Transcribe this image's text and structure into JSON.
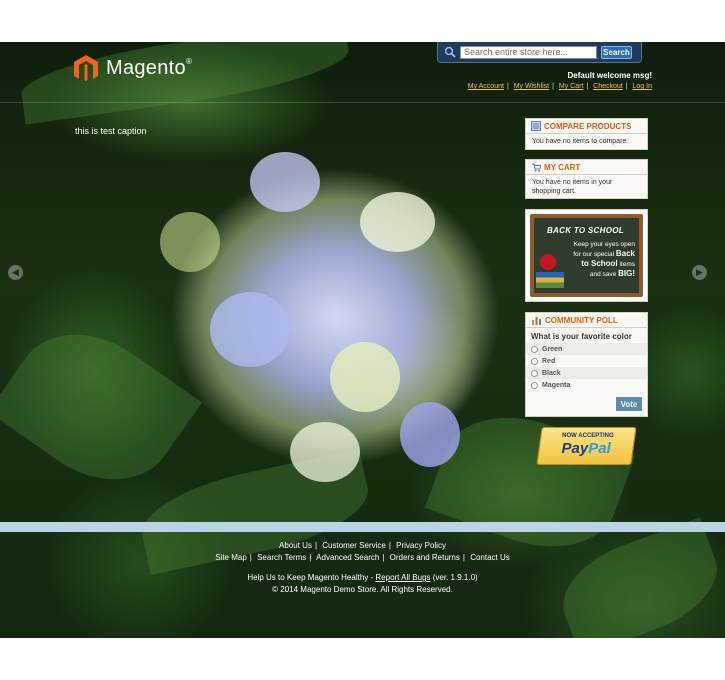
{
  "header": {
    "logo_text": "Magento",
    "logo_mark": "®",
    "search": {
      "placeholder": "Search entire store here...",
      "button_label": "Search"
    },
    "welcome": "Default welcome msg!",
    "links": [
      "My Account",
      "My Wishlist",
      "My Cart",
      "Checkout",
      "Log In"
    ]
  },
  "slider": {
    "caption": "this is test caption",
    "prev_icon": "chevron-left-icon",
    "next_icon": "chevron-right-icon"
  },
  "sidebar": {
    "compare": {
      "title": "Compare Products",
      "empty": "You have no items to compare."
    },
    "cart": {
      "title": "My Cart",
      "empty": "You have no items in your shopping cart."
    },
    "school_banner": {
      "heading": "BACK TO SCHOOL",
      "line1": "Keep your eyes open",
      "line2": "for our special",
      "em1": "Back",
      "line3": "to School",
      "line4": "items",
      "line5": "and save",
      "em2": "BIG!"
    },
    "poll": {
      "title": "Community Poll",
      "question": "What is your favorite color",
      "options": [
        "Green",
        "Red",
        "Black",
        "Magenta"
      ],
      "vote_label": "Vote"
    },
    "paypal": {
      "accepting": "NOW ACCEPTING",
      "brand_1": "Pay",
      "brand_2": "Pal"
    }
  },
  "footer": {
    "row1": [
      "About Us",
      "Customer Service",
      "Privacy Policy"
    ],
    "row2": [
      "Site Map",
      "Search Terms",
      "Advanced Search",
      "Orders and Returns",
      "Contact Us"
    ],
    "help_prefix": "Help Us to Keep Magento Healthy -",
    "report_link": "Report All Bugs",
    "version": "(ver. 1.9.1.0)",
    "copyright": "© 2014 Magento Demo Store. All Rights Reserved."
  },
  "colors": {
    "accent": "#e25d0f",
    "link": "#f2c34b",
    "search_bg": "#1e3c5a",
    "footer_band": "#bcd3e3"
  }
}
